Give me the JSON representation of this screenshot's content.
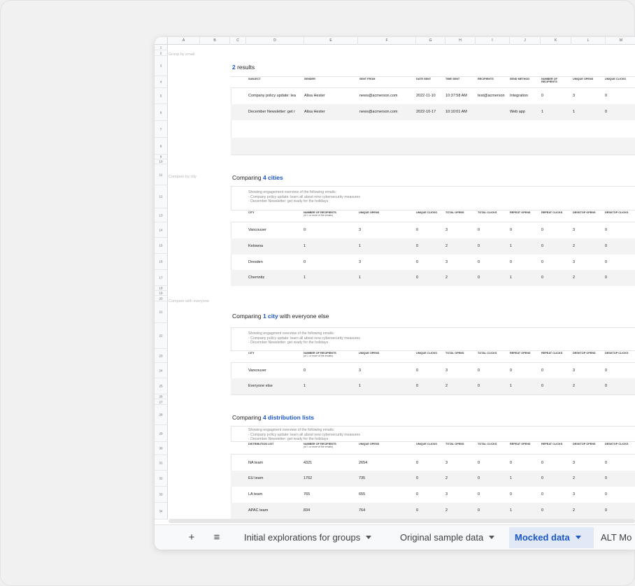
{
  "columns": [
    "A",
    "B",
    "C",
    "D",
    "E",
    "F",
    "G",
    "H",
    "I",
    "J",
    "K",
    "L",
    "M"
  ],
  "sides": {
    "group_by_email": "Group by email",
    "compare_by_city": "Compare by city",
    "compare_with_everyone": "Compare with everyone"
  },
  "sec1": {
    "count": "2",
    "title_rest": " results",
    "headers": [
      "SUBJECT",
      "SENDER",
      "SENT FROM",
      "DATE SENT",
      "TIME SENT",
      "RECIPIENTS",
      "SEND METHOD",
      "NUMBER OF RECIPIENTS",
      "UNIQUE OPENS",
      "UNIQUE CLICKS"
    ],
    "rows": [
      [
        "Company policy update: lea",
        "Alisa Hester",
        "news@acmerson.com",
        "2022-11-10",
        "10:37:58 AM",
        "test@acmerson",
        "Integration",
        "0",
        "3",
        "0"
      ],
      [
        "December Newsletter: get r",
        "Alisa Hester",
        "news@acmerson.com",
        "2022-10-17",
        "10:10:01 AM",
        "",
        "Web app",
        "1",
        "1",
        "0"
      ]
    ]
  },
  "note_text": "Showing engagement overview of the following emails:\n- Company policy update: learn all about new cybersecurity measures\n- December Newsletter: get ready for the holidays",
  "note_text_b": "Showing engagment overview of the following emails:\n- Company policy update: learn all about new cybersecurity measures\n- December Newsletter: get ready for the holidays",
  "metric_headers": [
    "UNIQUE OPENS",
    "UNIQUE CLICKS",
    "TOTAL OPENS",
    "TOTAL CLICKS",
    "REPEAT OPENS",
    "REPEAT CLICKS",
    "DESKTOP OPENS",
    "DESKTOP CLICKS"
  ],
  "recip_header": "NUMBER OF RECIPIENTS",
  "recip_sub": "(of 1 or more of the emails)",
  "sec2": {
    "prefix": "Comparing ",
    "highlight": "4 cities",
    "suffix": "",
    "first_header": "CITY",
    "rows": [
      [
        "Vancouver",
        "0",
        "3",
        "0",
        "3",
        "0",
        "0",
        "0",
        "3",
        "0"
      ],
      [
        "Kelowna",
        "1",
        "1",
        "0",
        "2",
        "0",
        "1",
        "0",
        "2",
        "0"
      ],
      [
        "Dresden",
        "0",
        "3",
        "0",
        "3",
        "0",
        "0",
        "0",
        "3",
        "0"
      ],
      [
        "Chemnitz",
        "1",
        "1",
        "0",
        "2",
        "0",
        "1",
        "0",
        "2",
        "0"
      ]
    ]
  },
  "sec3": {
    "prefix": "Comparing ",
    "highlight": "1 city",
    "suffix": " with everyone else",
    "first_header": "CITY",
    "rows": [
      [
        "Vancouver",
        "0",
        "3",
        "0",
        "3",
        "0",
        "0",
        "0",
        "3",
        "0"
      ],
      [
        "Everyone else",
        "1",
        "1",
        "0",
        "2",
        "0",
        "1",
        "0",
        "2",
        "0"
      ]
    ]
  },
  "sec4": {
    "prefix": "Comparing ",
    "highlight": "4 distribution lists",
    "suffix": "",
    "first_header": "DISTRIBUTION LIST",
    "rows": [
      [
        "NA team",
        "4321",
        "2654",
        "0",
        "3",
        "0",
        "0",
        "0",
        "3",
        "0"
      ],
      [
        "EU team",
        "1762",
        "735",
        "0",
        "2",
        "0",
        "1",
        "0",
        "2",
        "0"
      ],
      [
        "LA team",
        "765",
        "655",
        "0",
        "3",
        "0",
        "0",
        "0",
        "3",
        "0"
      ],
      [
        "APAC team",
        "834",
        "764",
        "0",
        "2",
        "0",
        "1",
        "0",
        "2",
        "0"
      ]
    ]
  },
  "tabbar": {
    "add_symbol": "+",
    "menu_symbol": "≡",
    "tabs": [
      {
        "label": "Initial explorations for groups",
        "active": false
      },
      {
        "label": "Original sample data",
        "active": false
      },
      {
        "label": "Mocked data",
        "active": true
      },
      {
        "label": "ALT Mo",
        "active": false
      }
    ]
  },
  "colors": {
    "accent": "#1a56c8",
    "active_tab_bg": "#e1e9f7"
  }
}
